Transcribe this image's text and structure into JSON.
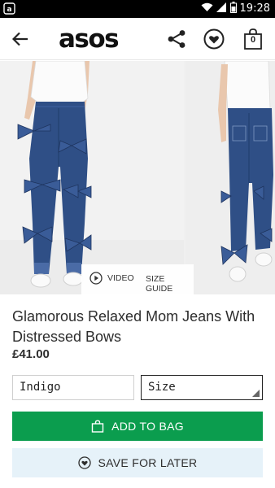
{
  "status_bar": {
    "time": "19:28"
  },
  "header": {
    "logo": "asos",
    "bag_count": "0"
  },
  "gallery": {
    "video_label": "VIDEO",
    "size_guide_label": "SIZE GUIDE"
  },
  "product": {
    "title": "Glamorous Relaxed Mom Jeans With Distressed Bows",
    "price": "£41.00"
  },
  "selectors": {
    "colour_value": "Indigo",
    "size_placeholder": "Size"
  },
  "actions": {
    "add_to_bag_label": "ADD TO BAG",
    "save_for_later_label": "SAVE FOR LATER"
  },
  "colors": {
    "add_to_bag_bg": "#0b9d4e",
    "save_for_later_bg": "#e6f2f9",
    "denim": "#2f4f86"
  }
}
